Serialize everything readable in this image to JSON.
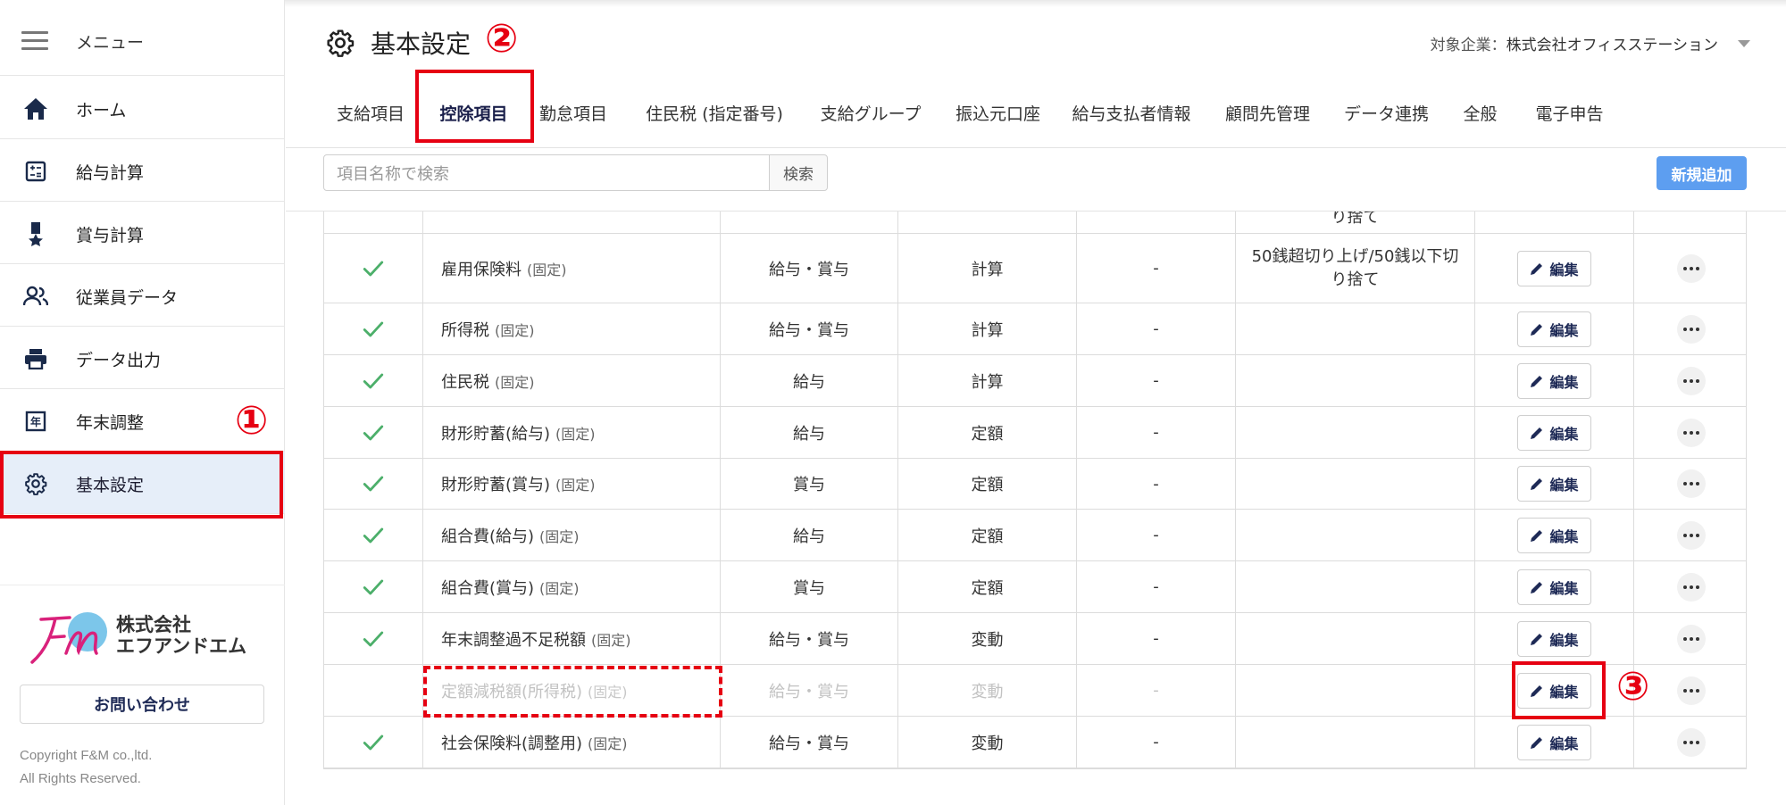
{
  "sidebar": {
    "menu_label": "メニュー",
    "items": [
      {
        "label": "ホーム",
        "icon": "home-icon"
      },
      {
        "label": "給与計算",
        "icon": "calculator-icon"
      },
      {
        "label": "賞与計算",
        "icon": "medal-icon"
      },
      {
        "label": "従業員データ",
        "icon": "people-icon"
      },
      {
        "label": "データ出力",
        "icon": "printer-icon"
      },
      {
        "label": "年末調整",
        "icon": "year-end-icon"
      },
      {
        "label": "基本設定",
        "icon": "gear-icon",
        "active": true
      }
    ],
    "logo_text_line1": "株式会社",
    "logo_text_line2": "エフアンドエム",
    "contact_label": "お問い合わせ",
    "copyright_line1": "Copyright F&M co.,ltd.",
    "copyright_line2": "All Rights Reserved."
  },
  "header": {
    "title": "基本設定",
    "company_label": "対象企業：",
    "company_name": "株式会社オフィスステーション"
  },
  "tabs": [
    {
      "label": "支給項目"
    },
    {
      "label": "控除項目",
      "active": true
    },
    {
      "label": "勤怠項目"
    },
    {
      "label": "住民税 (指定番号)"
    },
    {
      "label": "支給グループ"
    },
    {
      "label": "振込元口座"
    },
    {
      "label": "給与支払者情報"
    },
    {
      "label": "顧問先管理"
    },
    {
      "label": "データ連携"
    },
    {
      "label": "全般"
    },
    {
      "label": "電子申告"
    }
  ],
  "search": {
    "placeholder": "項目名称で検索",
    "button_label": "検索",
    "add_button_label": "新規追加"
  },
  "table": {
    "fixed_tag": "(固定)",
    "edit_label": "編集",
    "partial_top": {
      "rounding": "り捨て"
    },
    "rows": [
      {
        "checked": true,
        "name": "雇用保険料",
        "target": "給与・賞与",
        "method": "計算",
        "dash": "-",
        "rounding_1": "50銭超切り上げ/50銭以下切",
        "rounding_2": "り捨て"
      },
      {
        "checked": true,
        "name": "所得税",
        "target": "給与・賞与",
        "method": "計算",
        "dash": "-"
      },
      {
        "checked": true,
        "name": "住民税",
        "target": "給与",
        "method": "計算",
        "dash": "-"
      },
      {
        "checked": true,
        "name": "財形貯蓄(給与)",
        "target": "給与",
        "method": "定額",
        "dash": "-"
      },
      {
        "checked": true,
        "name": "財形貯蓄(賞与)",
        "target": "賞与",
        "method": "定額",
        "dash": "-"
      },
      {
        "checked": true,
        "name": "組合費(給与)",
        "target": "給与",
        "method": "定額",
        "dash": "-"
      },
      {
        "checked": true,
        "name": "組合費(賞与)",
        "target": "賞与",
        "method": "定額",
        "dash": "-"
      },
      {
        "checked": true,
        "name": "年末調整過不足税額",
        "target": "給与・賞与",
        "method": "変動",
        "dash": "-"
      },
      {
        "checked": false,
        "disabled": true,
        "name": "定額減税額(所得税)",
        "target": "給与・賞与",
        "method": "変動",
        "dash": "-"
      },
      {
        "checked": true,
        "name": "社会保険料(調整用)",
        "target": "給与・賞与",
        "method": "変動",
        "dash": "-"
      }
    ]
  },
  "annotations": {
    "n1": "①",
    "n2": "②",
    "n3": "③",
    "color": "#e60012"
  }
}
